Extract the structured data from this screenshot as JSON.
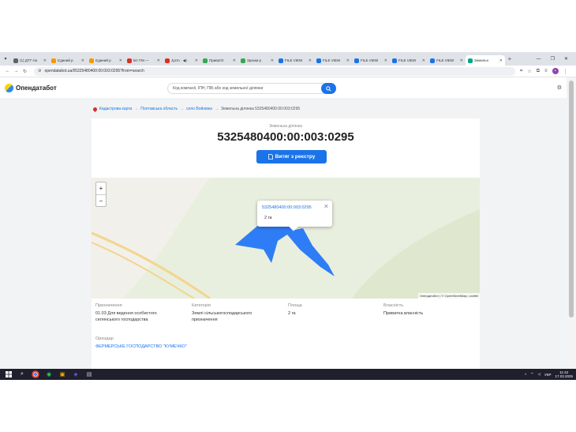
{
  "browser": {
    "tabs": [
      {
        "title": "(1) ДТТ Но",
        "color": "#5f6368"
      },
      {
        "title": "Єдиний р",
        "color": "#f29900"
      },
      {
        "title": "Єдиний р",
        "color": "#f29900"
      },
      {
        "title": "Біт FM —",
        "color": "#d93025"
      },
      {
        "title": "Jyzrn · ◀)",
        "color": "#d93025"
      },
      {
        "title": "ПриватО",
        "color": "#34a853"
      },
      {
        "title": "Зразки р",
        "color": "#34a853"
      },
      {
        "title": "FILE VIEW",
        "color": "#1a73e8"
      },
      {
        "title": "FILE VIEW",
        "color": "#1a73e8"
      },
      {
        "title": "FILE VIEW",
        "color": "#1a73e8"
      },
      {
        "title": "FILE VIEW",
        "color": "#1a73e8"
      },
      {
        "title": "FILE VIEW",
        "color": "#1a73e8"
      },
      {
        "title": "Земельн",
        "color": "#00a884"
      }
    ],
    "url": "opendatabot.ua/l/5325480400:00:003:0295?from=search"
  },
  "site": {
    "logo": "Опендатабот",
    "search_placeholder": "Код компанії, ІПН, ПІБ або код земельної ділянки"
  },
  "breadcrumb": {
    "items": [
      "Кадастрова карта",
      "Полтавська область",
      "село Войнівка"
    ],
    "current": "Земельна ділянка 5325480400:00:003:0295",
    "separator": "→"
  },
  "parcel": {
    "caption": "Земельна ділянка",
    "id": "5325480400:00:003:0295",
    "extract_button": "Витяг з реєстру"
  },
  "map": {
    "popup_link": "5325480400:00:003:0295",
    "popup_area": "2 га",
    "zoom_in": "+",
    "zoom_out": "−",
    "attribution": "Опендатабот | © OpenStreetMap, Leaflet",
    "parcel_color": "#2f7df6"
  },
  "details": {
    "purpose_label": "Призначення",
    "purpose_line1": "01.03 Для ведення особистого",
    "purpose_line2": "селянського господарства",
    "category_label": "Категорія",
    "category_line1": "Землі сільськогосподарського",
    "category_line2": "призначення",
    "area_label": "Площа",
    "area_value": "2 га",
    "ownership_label": "Власність",
    "ownership_value": "Приватна власність",
    "lessee_label": "Орендар",
    "lessee_value": "ФЕРМЕРСЬКЕ ГОСПОДАРСТВО \"КУМЕЧКО\""
  },
  "taskbar": {
    "lang": "УКР",
    "time": "11:42",
    "date": "17.03.2025"
  }
}
